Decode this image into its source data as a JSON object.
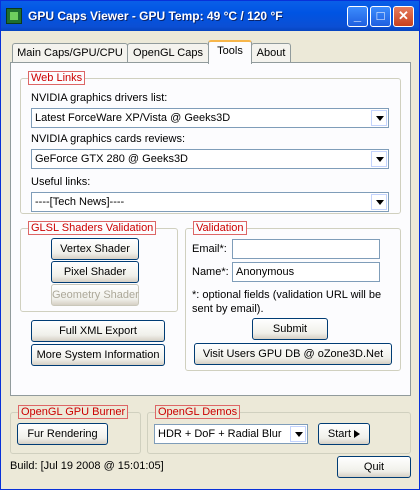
{
  "window": {
    "title": "GPU Caps Viewer - GPU Temp: 49 °C / 120 °F",
    "minimize": "_",
    "maximize": "□",
    "close": "✕"
  },
  "tabs": [
    {
      "label": "Main Caps/GPU/CPU",
      "active": false
    },
    {
      "label": "OpenGL Caps",
      "active": false
    },
    {
      "label": "Tools",
      "active": true
    },
    {
      "label": "About",
      "active": false
    }
  ],
  "web_links": {
    "title": "Web Links",
    "drivers_label": "NVIDIA graphics drivers list:",
    "drivers_value": "Latest ForceWare XP/Vista @ Geeks3D",
    "reviews_label": "NVIDIA graphics cards reviews:",
    "reviews_value": "GeForce GTX 280 @ Geeks3D",
    "useful_label": "Useful links:",
    "useful_value": "----[Tech News]----"
  },
  "glsl": {
    "title": "GLSL Shaders Validation",
    "vertex": "Vertex Shader",
    "pixel": "Pixel Shader",
    "geometry": "Geometry Shader"
  },
  "validation": {
    "title": "Validation",
    "email_label": "Email*:",
    "email_value": "",
    "name_label": "Name*:",
    "name_value": "Anonymous",
    "note": "*: optional fields (validation URL will be sent by email).",
    "submit": "Submit",
    "visit": "Visit Users GPU DB @ oZone3D.Net"
  },
  "export": {
    "xml": "Full XML Export",
    "more": "More System Information"
  },
  "gpu_burner": {
    "title": "OpenGL GPU Burner",
    "button": "Fur Rendering"
  },
  "demos": {
    "title": "OpenGL Demos",
    "selected": "HDR + DoF + Radial Blur",
    "start": "Start"
  },
  "status": {
    "build": "Build: [Jul 19 2008 @ 15:01:05]"
  },
  "quit": "Quit",
  "icons": {
    "app": "gpu-caps-app-icon",
    "play": "play-icon"
  },
  "colors": {
    "titlebar": "#0054e3",
    "group_title": "#cc0000",
    "tab_highlight": "#f7b64b"
  }
}
